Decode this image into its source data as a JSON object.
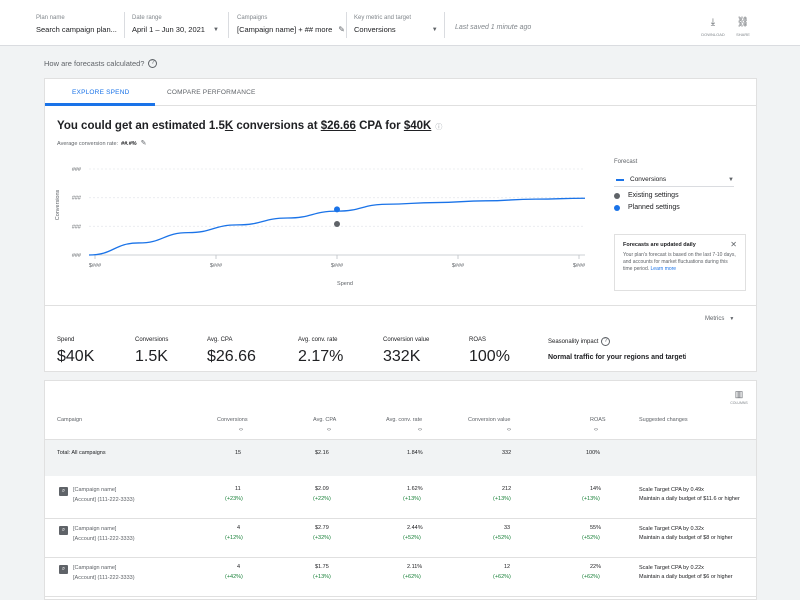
{
  "header": {
    "plan_name_label": "Plan name",
    "plan_name_value": "Search campaign plan...",
    "date_range_label": "Date range",
    "date_range_value": "April 1 – Jun 30, 2021",
    "campaigns_label": "Campaigns",
    "campaigns_value": "[Campaign name] + ## more",
    "key_metric_label": "Key metric and target",
    "key_metric_value": "Conversions",
    "saved_text": "Last saved 1 minute ago",
    "download_label": "DOWNLOAD",
    "share_label": "SHARE"
  },
  "how_forecasts": "How are forecasts calculated?",
  "tabs": [
    "EXPLORE SPEND",
    "COMPARE PERFORMANCE"
  ],
  "headline": {
    "prefix": "You could get an estimated 1.5",
    "conv_unit": "K",
    "mid": " conversions at ",
    "cpa": "$26.66",
    "mid2": " CPA for ",
    "budget": "$40K"
  },
  "avg_conversion": {
    "label": "Average conversion rate:",
    "value": "##.#%"
  },
  "chart_data": {
    "type": "line",
    "xlabel": "Spend",
    "ylabel": "Conversions",
    "x_tick_labels": [
      "$###",
      "$###",
      "$###",
      "$###",
      "$###"
    ],
    "y_tick_labels": [
      "###",
      "###",
      "###",
      "###"
    ],
    "series": [
      {
        "name": "Conversions",
        "x": [
          0,
          0.1,
          0.2,
          0.3,
          0.4,
          0.5,
          0.6,
          0.7,
          0.8,
          0.9,
          1.0
        ],
        "y": [
          0.0,
          0.14,
          0.26,
          0.35,
          0.43,
          0.51,
          0.59,
          0.61,
          0.63,
          0.65,
          0.66
        ]
      }
    ],
    "existing_point": {
      "x": 0.5,
      "y": 0.36
    },
    "planned_point": {
      "x": 0.5,
      "y": 0.53
    },
    "ylim": [
      0,
      1
    ],
    "xlim": [
      0,
      1
    ],
    "grid": true,
    "legend": "right"
  },
  "forecast_panel": {
    "title": "Forecast",
    "selected": "Conversions",
    "existing": "Existing settings",
    "planned": "Planned settings",
    "colors": {
      "line": "#1a73e8",
      "existing": "#5f6368",
      "planned": "#1a73e8"
    }
  },
  "notice": {
    "title": "Forecasts are updated daily",
    "body": "Your plan's forecast is based on the last 7-10 days, and accounts for market fluctuations during this time period.",
    "link": "Learn more"
  },
  "metrics_dropdown": "Metrics",
  "stats": [
    {
      "label": "Spend",
      "value": "$40K"
    },
    {
      "label": "Conversions",
      "value": "1.5K"
    },
    {
      "label": "Avg. CPA",
      "value": "$26.66"
    },
    {
      "label": "Avg. conv. rate",
      "value": "2.17%"
    },
    {
      "label": "Conversion value",
      "value": "332K"
    },
    {
      "label": "ROAS",
      "value": "100%"
    }
  ],
  "seasonality": {
    "label": "Seasonality impact",
    "value": "Normal traffic for your regions and targeting"
  },
  "table": {
    "columns_label": "COLUMNS",
    "headers": [
      "Campaign",
      "Conversions",
      "Avg. CPA",
      "Avg. conv. rate",
      "Conversion value",
      "ROAS",
      "Suggested changes"
    ],
    "total": {
      "name": "Total: All campaigns",
      "values": [
        "15",
        "$2.16",
        "1.84%",
        "332",
        "100%"
      ]
    },
    "rows": [
      {
        "name": "[Campaign name]",
        "account": "[Account] (111-222-3333)",
        "values": [
          "11",
          "$2.09",
          "1.62%",
          "212",
          "14%"
        ],
        "deltas": [
          "(+23%)",
          "(+22%)",
          "(+13%)",
          "(+13%)",
          "(+13%)"
        ],
        "s1": "Scale Target CPA by 0.49x",
        "s2": "Maintain a daily budget of $11.6 or higher"
      },
      {
        "name": "[Campaign name]",
        "account": "[Account] (111-222-3333)",
        "values": [
          "4",
          "$2.79",
          "2.44%",
          "33",
          "55%"
        ],
        "deltas": [
          "(+12%)",
          "(+32%)",
          "(+52%)",
          "(+52%)",
          "(+52%)"
        ],
        "s1": "Scale Target CPA by 0.32x",
        "s2": "Maintain a daily budget of $8 or higher"
      },
      {
        "name": "[Campaign name]",
        "account": "[Account] (111-222-3333)",
        "values": [
          "4",
          "$1.75",
          "2.11%",
          "12",
          "22%"
        ],
        "deltas": [
          "(+42%)",
          "(+13%)",
          "(+62%)",
          "(+62%)",
          "(+62%)"
        ],
        "s1": "Scale Target CPA by 0.22x",
        "s2": "Maintain a daily budget of $6 or higher"
      }
    ]
  }
}
